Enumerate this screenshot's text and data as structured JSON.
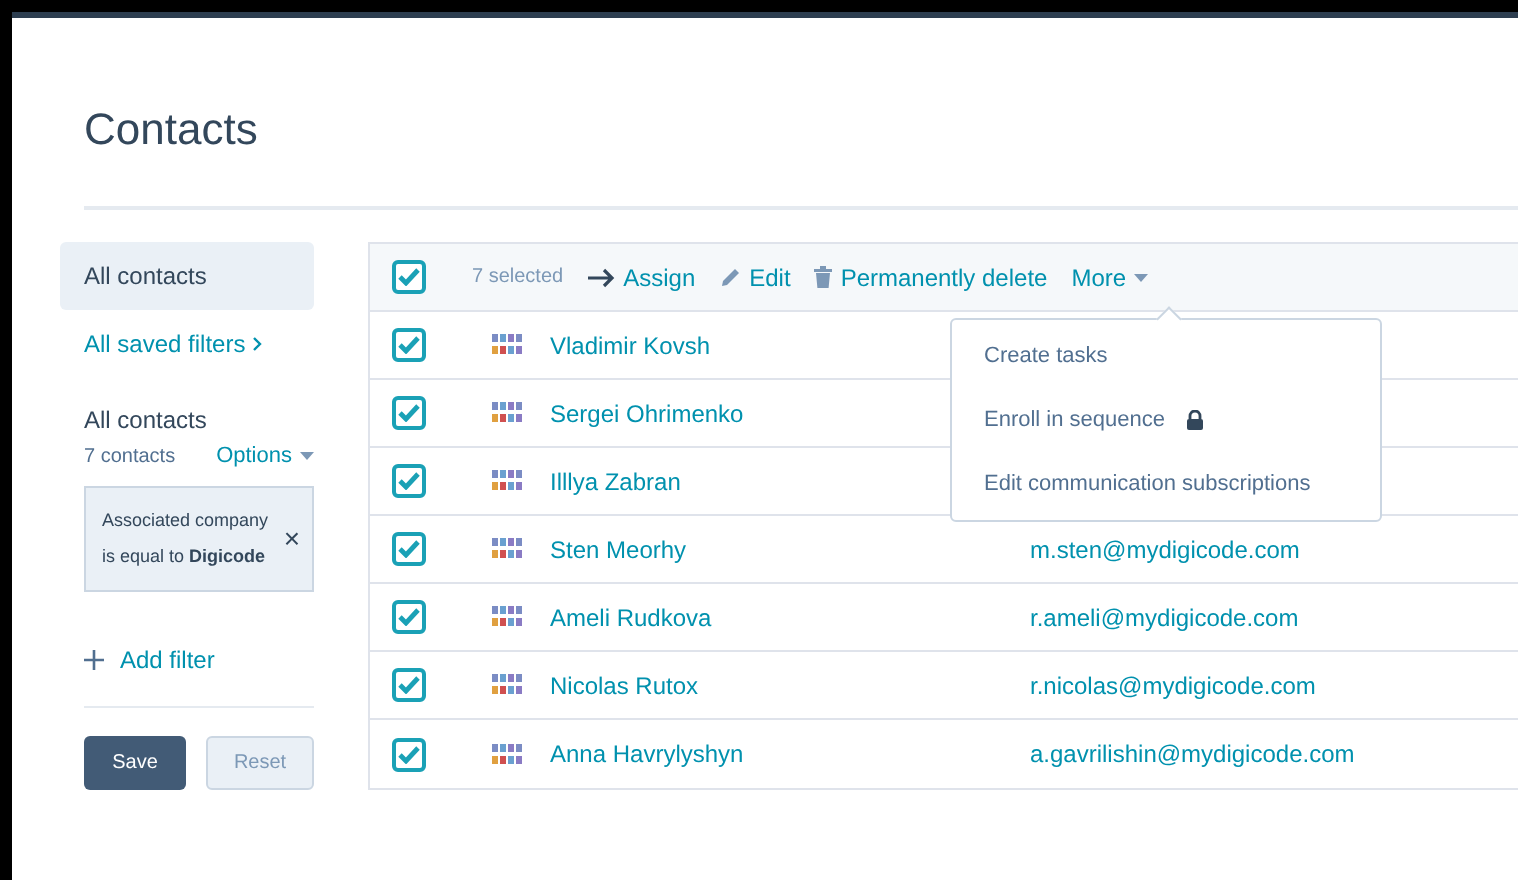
{
  "page": {
    "title": "Contacts"
  },
  "sidebar": {
    "items": [
      {
        "label": "All contacts",
        "selected": true
      },
      {
        "label": "All saved filters",
        "selected": false
      }
    ],
    "view": {
      "title": "All contacts",
      "count": "7 contacts",
      "options": "Options"
    },
    "filter": {
      "text": "Associated company is equal to **Digicode**",
      "remove": "×"
    },
    "add_filter": "Add filter",
    "buttons": [
      {
        "label": "Save",
        "kind": "primary"
      },
      {
        "label": "Reset",
        "kind": "secondary"
      }
    ]
  },
  "toolbar": {
    "all_checked": true,
    "selected_count": "7 selected",
    "actions": [
      {
        "label": "Assign",
        "kind": "arrow"
      },
      {
        "label": "Edit",
        "kind": "pencil"
      },
      {
        "label": "Permanently delete",
        "kind": "trash"
      },
      {
        "label": "More",
        "kind": "caret"
      }
    ]
  },
  "menu": {
    "items": [
      {
        "label": "Create tasks",
        "locked": false
      },
      {
        "label": "Enroll in sequence",
        "locked": true
      },
      {
        "label": "Edit communication subscriptions",
        "locked": false
      }
    ]
  },
  "rows": [
    {
      "name": "Vladimir Kovsh",
      "checked": true
    },
    {
      "name": "Sergei Ohrimenko",
      "checked": true
    },
    {
      "name": "Illlya Zabran",
      "checked": true
    },
    {
      "name": "Sten Meorhy",
      "email": "m.sten@mydigicode.com",
      "checked": true
    },
    {
      "name": "Ameli Rudkova",
      "email": "r.ameli@mydigicode.com",
      "checked": true
    },
    {
      "name": "Nicolas Rutox",
      "email": "r.nicolas@mydigicode.com",
      "checked": true
    },
    {
      "name": "Anna Havrylyshyn",
      "email": "a.gavrilishin@mydigicode.com",
      "checked": true
    }
  ]
}
